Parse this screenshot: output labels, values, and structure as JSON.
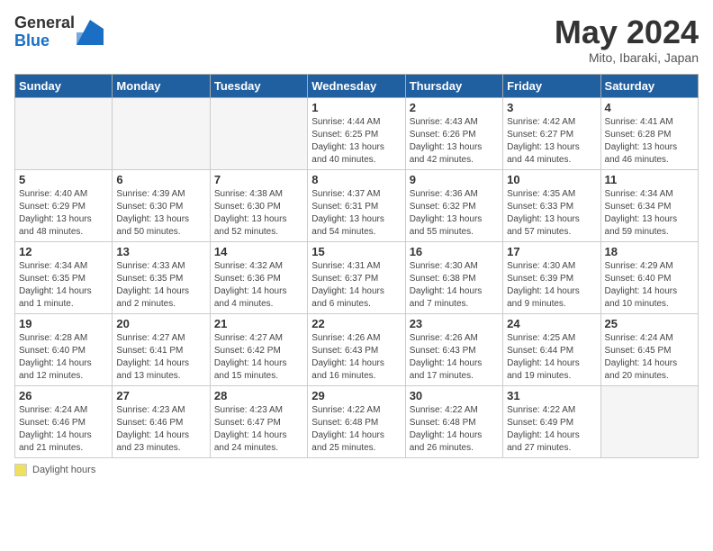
{
  "header": {
    "logo_general": "General",
    "logo_blue": "Blue",
    "month_title": "May 2024",
    "location": "Mito, Ibaraki, Japan"
  },
  "columns": [
    "Sunday",
    "Monday",
    "Tuesday",
    "Wednesday",
    "Thursday",
    "Friday",
    "Saturday"
  ],
  "weeks": [
    [
      {
        "day": "",
        "info": ""
      },
      {
        "day": "",
        "info": ""
      },
      {
        "day": "",
        "info": ""
      },
      {
        "day": "1",
        "info": "Sunrise: 4:44 AM\nSunset: 6:25 PM\nDaylight: 13 hours\nand 40 minutes."
      },
      {
        "day": "2",
        "info": "Sunrise: 4:43 AM\nSunset: 6:26 PM\nDaylight: 13 hours\nand 42 minutes."
      },
      {
        "day": "3",
        "info": "Sunrise: 4:42 AM\nSunset: 6:27 PM\nDaylight: 13 hours\nand 44 minutes."
      },
      {
        "day": "4",
        "info": "Sunrise: 4:41 AM\nSunset: 6:28 PM\nDaylight: 13 hours\nand 46 minutes."
      }
    ],
    [
      {
        "day": "5",
        "info": "Sunrise: 4:40 AM\nSunset: 6:29 PM\nDaylight: 13 hours\nand 48 minutes."
      },
      {
        "day": "6",
        "info": "Sunrise: 4:39 AM\nSunset: 6:30 PM\nDaylight: 13 hours\nand 50 minutes."
      },
      {
        "day": "7",
        "info": "Sunrise: 4:38 AM\nSunset: 6:30 PM\nDaylight: 13 hours\nand 52 minutes."
      },
      {
        "day": "8",
        "info": "Sunrise: 4:37 AM\nSunset: 6:31 PM\nDaylight: 13 hours\nand 54 minutes."
      },
      {
        "day": "9",
        "info": "Sunrise: 4:36 AM\nSunset: 6:32 PM\nDaylight: 13 hours\nand 55 minutes."
      },
      {
        "day": "10",
        "info": "Sunrise: 4:35 AM\nSunset: 6:33 PM\nDaylight: 13 hours\nand 57 minutes."
      },
      {
        "day": "11",
        "info": "Sunrise: 4:34 AM\nSunset: 6:34 PM\nDaylight: 13 hours\nand 59 minutes."
      }
    ],
    [
      {
        "day": "12",
        "info": "Sunrise: 4:34 AM\nSunset: 6:35 PM\nDaylight: 14 hours\nand 1 minute."
      },
      {
        "day": "13",
        "info": "Sunrise: 4:33 AM\nSunset: 6:35 PM\nDaylight: 14 hours\nand 2 minutes."
      },
      {
        "day": "14",
        "info": "Sunrise: 4:32 AM\nSunset: 6:36 PM\nDaylight: 14 hours\nand 4 minutes."
      },
      {
        "day": "15",
        "info": "Sunrise: 4:31 AM\nSunset: 6:37 PM\nDaylight: 14 hours\nand 6 minutes."
      },
      {
        "day": "16",
        "info": "Sunrise: 4:30 AM\nSunset: 6:38 PM\nDaylight: 14 hours\nand 7 minutes."
      },
      {
        "day": "17",
        "info": "Sunrise: 4:30 AM\nSunset: 6:39 PM\nDaylight: 14 hours\nand 9 minutes."
      },
      {
        "day": "18",
        "info": "Sunrise: 4:29 AM\nSunset: 6:40 PM\nDaylight: 14 hours\nand 10 minutes."
      }
    ],
    [
      {
        "day": "19",
        "info": "Sunrise: 4:28 AM\nSunset: 6:40 PM\nDaylight: 14 hours\nand 12 minutes."
      },
      {
        "day": "20",
        "info": "Sunrise: 4:27 AM\nSunset: 6:41 PM\nDaylight: 14 hours\nand 13 minutes."
      },
      {
        "day": "21",
        "info": "Sunrise: 4:27 AM\nSunset: 6:42 PM\nDaylight: 14 hours\nand 15 minutes."
      },
      {
        "day": "22",
        "info": "Sunrise: 4:26 AM\nSunset: 6:43 PM\nDaylight: 14 hours\nand 16 minutes."
      },
      {
        "day": "23",
        "info": "Sunrise: 4:26 AM\nSunset: 6:43 PM\nDaylight: 14 hours\nand 17 minutes."
      },
      {
        "day": "24",
        "info": "Sunrise: 4:25 AM\nSunset: 6:44 PM\nDaylight: 14 hours\nand 19 minutes."
      },
      {
        "day": "25",
        "info": "Sunrise: 4:24 AM\nSunset: 6:45 PM\nDaylight: 14 hours\nand 20 minutes."
      }
    ],
    [
      {
        "day": "26",
        "info": "Sunrise: 4:24 AM\nSunset: 6:46 PM\nDaylight: 14 hours\nand 21 minutes."
      },
      {
        "day": "27",
        "info": "Sunrise: 4:23 AM\nSunset: 6:46 PM\nDaylight: 14 hours\nand 23 minutes."
      },
      {
        "day": "28",
        "info": "Sunrise: 4:23 AM\nSunset: 6:47 PM\nDaylight: 14 hours\nand 24 minutes."
      },
      {
        "day": "29",
        "info": "Sunrise: 4:22 AM\nSunset: 6:48 PM\nDaylight: 14 hours\nand 25 minutes."
      },
      {
        "day": "30",
        "info": "Sunrise: 4:22 AM\nSunset: 6:48 PM\nDaylight: 14 hours\nand 26 minutes."
      },
      {
        "day": "31",
        "info": "Sunrise: 4:22 AM\nSunset: 6:49 PM\nDaylight: 14 hours\nand 27 minutes."
      },
      {
        "day": "",
        "info": ""
      }
    ]
  ],
  "footer": {
    "daylight_label": "Daylight hours"
  }
}
